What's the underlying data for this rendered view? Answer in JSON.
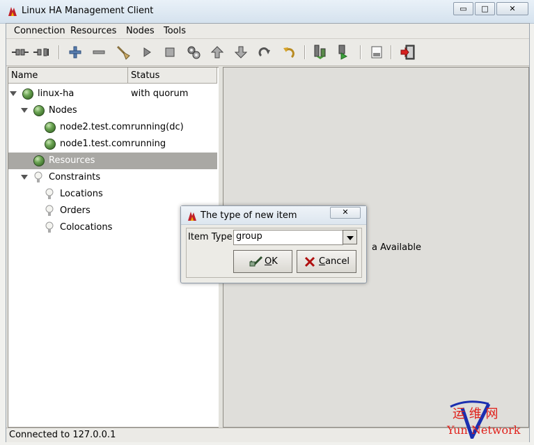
{
  "window": {
    "title": "Linux HA Management Client",
    "minimize": "▭",
    "maximize": "□",
    "close": "✕"
  },
  "menu": [
    "Connection",
    "Resources",
    "Nodes",
    "Tools"
  ],
  "toolbar_icons": [
    "connect-icon",
    "disconnect-icon",
    "add-icon",
    "remove-icon",
    "cleanup-icon",
    "start-icon",
    "stop-icon",
    "default-icon",
    "move-up-icon",
    "move-down-icon",
    "refresh-icon",
    "undo-icon",
    "standby-icon",
    "active-icon",
    "view-icon",
    "exit-icon"
  ],
  "tree": {
    "columns": [
      "Name",
      "Status"
    ],
    "rows": [
      {
        "label": "linux-ha",
        "status": "with quorum"
      },
      {
        "label": "Nodes",
        "status": ""
      },
      {
        "label": "node2.test.com",
        "status": "running(dc)"
      },
      {
        "label": "node1.test.com",
        "status": "running"
      },
      {
        "label": "Resources",
        "status": ""
      },
      {
        "label": "Constraints",
        "status": ""
      },
      {
        "label": "Locations",
        "status": ""
      },
      {
        "label": "Orders",
        "status": ""
      },
      {
        "label": "Colocations",
        "status": ""
      }
    ]
  },
  "detail": {
    "message": "a Available"
  },
  "status_bar": "Connected to 127.0.0.1",
  "dialog": {
    "title": "The type of new item",
    "close": "✕",
    "field_label": "Item Type:",
    "selected": "group",
    "ok_mnemonic": "O",
    "ok_rest": "K",
    "cancel_mnemonic": "C",
    "cancel_rest": "ancel"
  },
  "watermark": {
    "cn": "运 维 网",
    "en": "Yun Network"
  },
  "colors": {
    "selected_row": "#a9a8a4",
    "ball_green": "#69a251",
    "watermark_red": "#e0201a"
  }
}
